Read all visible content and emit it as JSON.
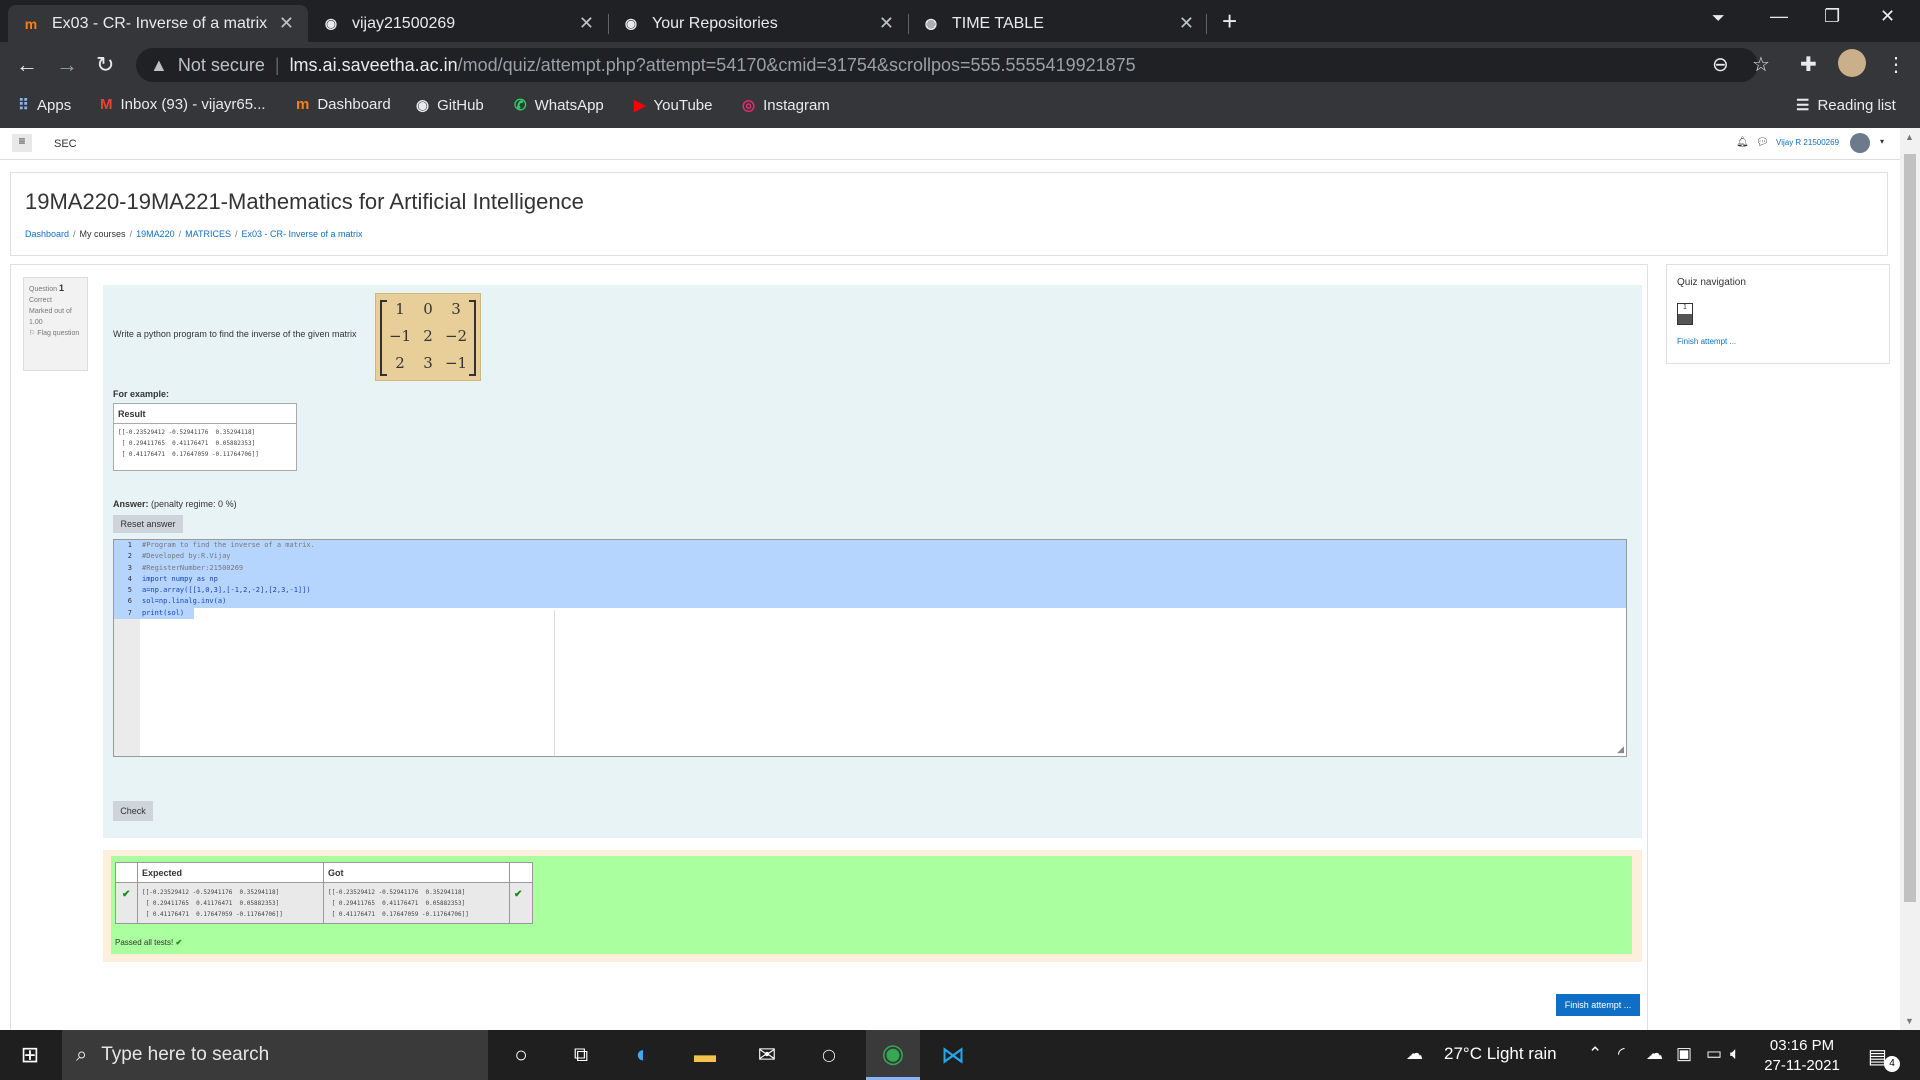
{
  "browser": {
    "tabs": [
      {
        "title": "Ex03 - CR- Inverse of a matrix",
        "favicon": "moodle-icon"
      },
      {
        "title": "vijay21500269",
        "favicon": "github-icon"
      },
      {
        "title": "Your Repositories",
        "favicon": "github-icon"
      },
      {
        "title": "TIME TABLE",
        "favicon": "globe-icon"
      }
    ],
    "address": {
      "security": "Not secure",
      "host": "lms.ai.saveetha.ac.in",
      "path": "/mod/quiz/attempt.php?attempt=54170&cmid=31754&scrollpos=555.5555419921875"
    },
    "bookmarks": [
      {
        "label": "Apps"
      },
      {
        "label": "Inbox (93) - vijayr65..."
      },
      {
        "label": "Dashboard"
      },
      {
        "label": "GitHub"
      },
      {
        "label": "WhatsApp"
      },
      {
        "label": "YouTube"
      },
      {
        "label": "Instagram"
      }
    ],
    "reading_list": "Reading list"
  },
  "moodle": {
    "site_short": "SEC",
    "user": "Vijay R 21500269",
    "course_title": "19MA220-19MA221-Mathematics for Artificial Intelligence",
    "breadcrumb": [
      "Dashboard",
      "My courses",
      "19MA220",
      "MATRICES",
      "Ex03 - CR- Inverse of a matrix"
    ]
  },
  "question": {
    "label": "Question",
    "number": "1",
    "status": "Correct",
    "mark": "Marked out of 1.00",
    "flag": "Flag question",
    "text": "Write a python program to find the inverse of the given matrix",
    "matrix": [
      [
        "1",
        "0",
        "3"
      ],
      [
        "−1",
        "2",
        "−2"
      ],
      [
        "2",
        "3",
        "−1"
      ]
    ],
    "for_example": "For example:",
    "result_header": "Result",
    "result_output": "[[-0.23529412 -0.52941176  0.35294118]\n [ 0.29411765  0.41176471  0.05882353]\n [ 0.41176471  0.17647059 -0.11764706]]",
    "answer_label": "Answer:",
    "penalty": "(penalty regime: 0 %)",
    "reset_label": "Reset answer",
    "code_lines": [
      {
        "n": "1",
        "text": "#Program to find the inverse of a matrix."
      },
      {
        "n": "2",
        "text": "#Developed by:R.Vijay"
      },
      {
        "n": "3",
        "text": "#RegisterNumber:21500269"
      },
      {
        "n": "4",
        "text": "import numpy as np"
      },
      {
        "n": "5",
        "text": "a=np.array([[1,0,3],[-1,2,-2],[2,3,-1]])"
      },
      {
        "n": "6",
        "text": "sol=np.linalg.inv(a)"
      },
      {
        "n": "7",
        "text": "print(sol)"
      }
    ],
    "check_label": "Check"
  },
  "results": {
    "expected_header": "Expected",
    "got_header": "Got",
    "expected": "[[-0.23529412 -0.52941176  0.35294118]\n [ 0.29411765  0.41176471  0.05882353]\n [ 0.41176471  0.17647059 -0.11764706]]",
    "got": "[[-0.23529412 -0.52941176  0.35294118]\n [ 0.29411765  0.41176471  0.05882353]\n [ 0.41176471  0.17647059 -0.11764706]]",
    "passed": "Passed all tests!"
  },
  "quiz_nav": {
    "title": "Quiz navigation",
    "question_button": "1",
    "finish_link": "Finish attempt ..."
  },
  "finish_button": "Finish attempt ...",
  "taskbar": {
    "search_placeholder": "Type here to search",
    "weather": "27°C  Light rain",
    "time": "03:16 PM",
    "date": "27-11-2021",
    "notifications": "4"
  },
  "colors": {
    "formulation_bg": "#e7f3f5",
    "correct_bg": "#aaff9f",
    "link": "#0f6fc5"
  }
}
